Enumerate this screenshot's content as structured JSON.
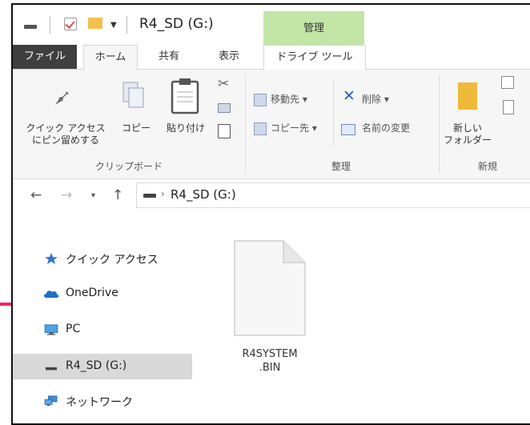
{
  "window": {
    "title": "R4_SD (G:)",
    "manage_tab": "管理"
  },
  "tabs": {
    "file": "ファイル",
    "home": "ホーム",
    "share": "共有",
    "view": "表示",
    "drive_tools": "ドライブ ツール"
  },
  "ribbon": {
    "clipboard": {
      "pin": "クイック アクセス\nにピン留めする",
      "copy": "コピー",
      "paste": "貼り付け",
      "group": "クリップボード"
    },
    "organize": {
      "move_to": "移動先",
      "copy_to": "コピー先",
      "delete": "削除",
      "rename": "名前の変更",
      "group": "整理"
    },
    "new": {
      "new_folder": "新しい\nフォルダー",
      "group": "新規"
    }
  },
  "address": {
    "path": "R4_SD (G:)"
  },
  "nav_pane": {
    "items": [
      {
        "label": "クイック アクセス",
        "icon": "star-icon"
      },
      {
        "label": "OneDrive",
        "icon": "cloud-icon"
      },
      {
        "label": "PC",
        "icon": "monitor-icon"
      },
      {
        "label": "R4_SD (G:)",
        "icon": "drive-icon"
      },
      {
        "label": "ネットワーク",
        "icon": "network-icon"
      }
    ]
  },
  "files": [
    {
      "name": "R4SYSTEM\n.BIN"
    }
  ],
  "colors": {
    "manage_tab": "#c3e6a7",
    "arrow": "#f0245e",
    "file_tab": "#3f3f3f"
  }
}
